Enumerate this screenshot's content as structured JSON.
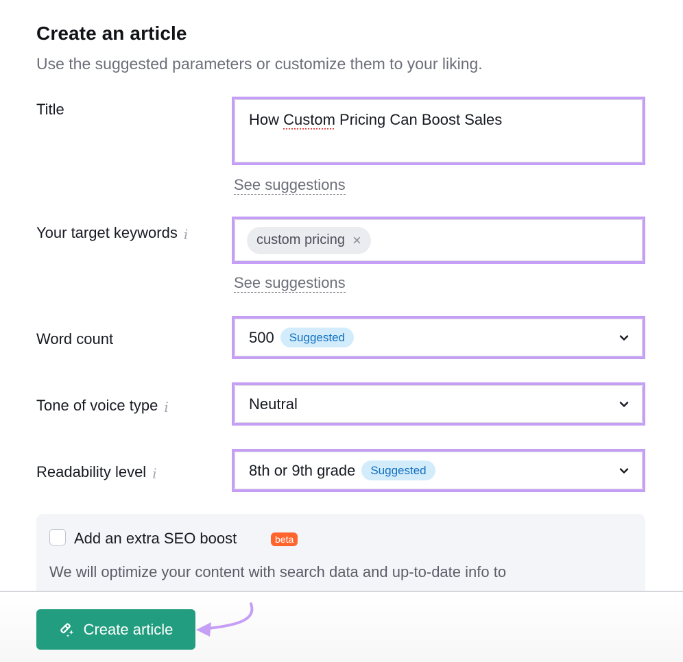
{
  "header": {
    "title": "Create an article",
    "subtitle": "Use the suggested parameters or customize them to your liking."
  },
  "fields": {
    "title": {
      "label": "Title",
      "value_before": "How ",
      "value_misspelled": "Custom",
      "value_after": " Pricing Can Boost Sales",
      "suggestions_link": "See suggestions"
    },
    "keywords": {
      "label": "Your target keywords",
      "info_icon": "i",
      "chips": [
        {
          "label": "custom pricing",
          "remove_icon": "×"
        }
      ],
      "suggestions_link": "See suggestions"
    },
    "word_count": {
      "label": "Word count",
      "value": "500",
      "badge": "Suggested"
    },
    "tone": {
      "label": "Tone of voice type",
      "info_icon": "i",
      "value": "Neutral"
    },
    "readability": {
      "label": "Readability level",
      "info_icon": "i",
      "value": "8th or 9th grade",
      "badge": "Suggested"
    }
  },
  "seo_boost": {
    "checked": false,
    "label": "Add an extra SEO boost",
    "badge": "beta",
    "description": "We will optimize your content with search data and up-to-date info to"
  },
  "footer": {
    "create_button": "Create article"
  },
  "colors": {
    "highlight": "#c59ef5",
    "primary_button": "#239d7f",
    "suggested_badge_bg": "#d3ecfc",
    "suggested_badge_text": "#0f6fbf",
    "beta_badge": "#ff642d"
  }
}
